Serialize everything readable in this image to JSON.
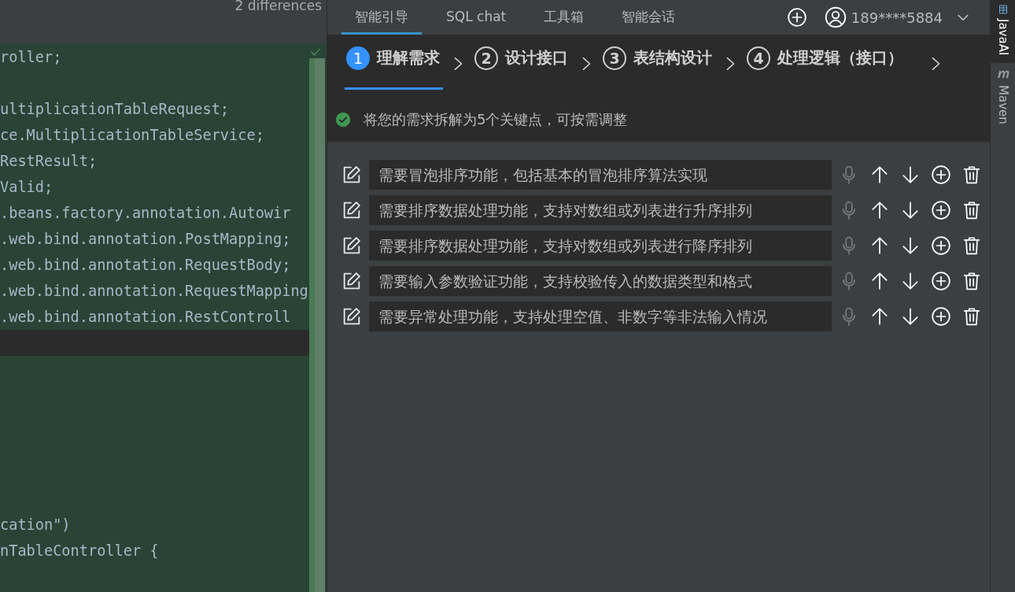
{
  "editor": {
    "header": "2 differences",
    "lines": [
      {
        "kind": "code",
        "text": "roller;"
      },
      {
        "kind": "blank"
      },
      {
        "kind": "code",
        "text": "ultiplicationTableRequest;"
      },
      {
        "kind": "code",
        "text": "ce.MultiplicationTableService;"
      },
      {
        "kind": "code",
        "text": "RestResult;"
      },
      {
        "kind": "code",
        "text": "Valid;"
      },
      {
        "kind": "code",
        "text": ".beans.factory.annotation.Autowir"
      },
      {
        "kind": "code",
        "text": ".web.bind.annotation.PostMapping;"
      },
      {
        "kind": "code",
        "text": ".web.bind.annotation.RequestBody;"
      },
      {
        "kind": "code",
        "text": ".web.bind.annotation.RequestMapping"
      },
      {
        "kind": "code",
        "text": ".web.bind.annotation.RestControll"
      },
      {
        "kind": "current"
      },
      {
        "kind": "blank"
      },
      {
        "kind": "blank"
      },
      {
        "kind": "blank"
      },
      {
        "kind": "blank"
      },
      {
        "kind": "blank"
      },
      {
        "kind": "blank"
      },
      {
        "kind": "code",
        "text": "cation\")"
      },
      {
        "kind": "code",
        "text": "nTableController {"
      }
    ]
  },
  "assistant": {
    "tabs": [
      {
        "label": "智能引导",
        "selected": true
      },
      {
        "label": "SQL chat",
        "selected": false
      },
      {
        "label": "工具箱",
        "selected": false
      },
      {
        "label": "智能会话",
        "selected": false
      }
    ],
    "account": "189****5884",
    "steps": [
      {
        "number": "1",
        "label": "理解需求",
        "selected": true
      },
      {
        "number": "2",
        "label": "设计接口",
        "selected": false
      },
      {
        "number": "3",
        "label": "表结构设计",
        "selected": false
      },
      {
        "number": "4",
        "label": "处理逻辑（接口）",
        "selected": false
      }
    ],
    "message": "将您的需求拆解为5个关键点，可按需调整",
    "points": [
      {
        "text": "需要冒泡排序功能，包括基本的冒泡排序算法实现"
      },
      {
        "text": "需要排序数据处理功能，支持对数组或列表进行升序排列"
      },
      {
        "text": "需要排序数据处理功能，支持对数组或列表进行降序排列"
      },
      {
        "text": "需要输入参数验证功能，支持校验传入的数据类型和格式"
      },
      {
        "text": "需要异常处理功能，支持处理空值、非数字等非法输入情况"
      }
    ]
  },
  "side_tools": [
    {
      "label": "JavaAI",
      "selected": true
    },
    {
      "label": "Maven",
      "selected": false
    }
  ]
}
